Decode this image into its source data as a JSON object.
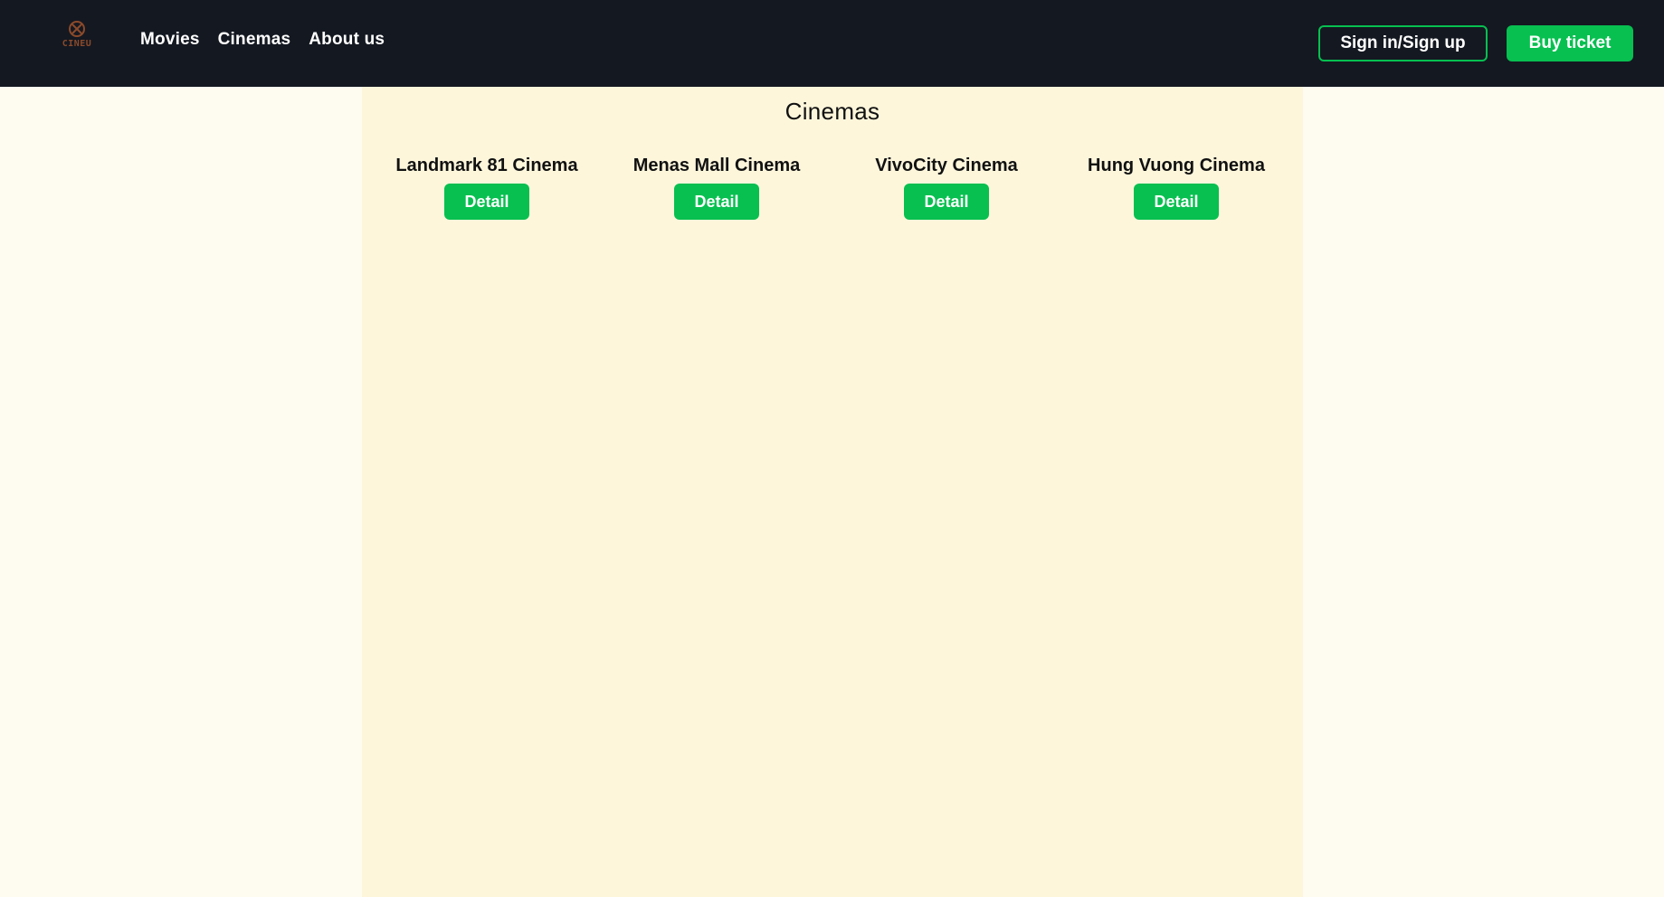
{
  "header": {
    "logo": {
      "text": "CINEU",
      "icon": "film-reel-icon"
    },
    "nav": [
      {
        "label": "Movies"
      },
      {
        "label": "Cinemas"
      },
      {
        "label": "About us"
      }
    ],
    "signin_label": "Sign in/Sign up",
    "buy_label": "Buy ticket"
  },
  "main": {
    "title": "Cinemas",
    "cinemas": [
      {
        "name": "Landmark 81 Cinema",
        "button": "Detail"
      },
      {
        "name": "Menas Mall Cinema",
        "button": "Detail"
      },
      {
        "name": "VivoCity Cinema",
        "button": "Detail"
      },
      {
        "name": "Hung Vuong Cinema",
        "button": "Detail"
      }
    ]
  },
  "colors": {
    "navbar_bg": "#141821",
    "accent_green": "#07c050",
    "content_bg": "#fdf6db",
    "page_bg": "#fefcf0"
  }
}
